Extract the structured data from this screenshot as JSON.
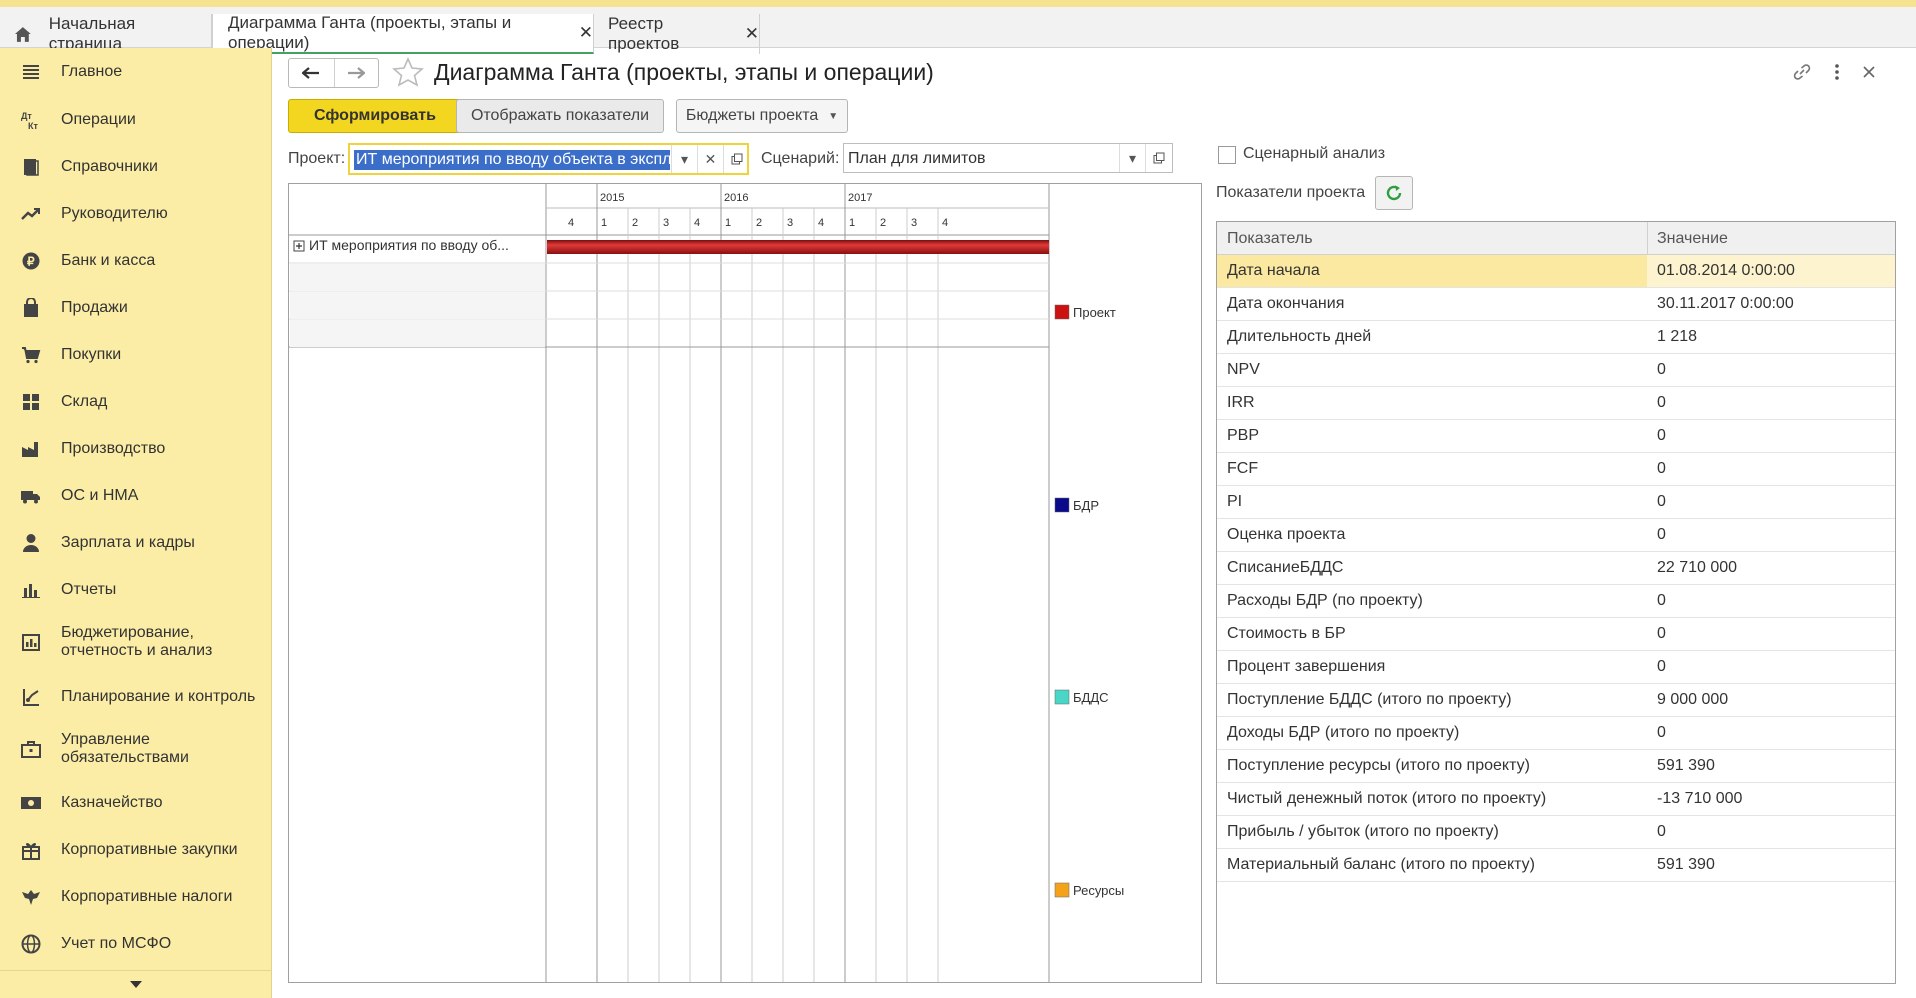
{
  "tabs": {
    "home": "Начальная страница",
    "gantt": "Диаграмма Ганта (проекты, этапы и операции)",
    "registry": "Реестр проектов"
  },
  "sidebar": {
    "items": [
      {
        "label": "Главное",
        "icon": "menu-icon"
      },
      {
        "label": "Операции",
        "icon": "dt-kt-icon"
      },
      {
        "label": "Справочники",
        "icon": "book-icon"
      },
      {
        "label": "Руководителю",
        "icon": "trend-icon"
      },
      {
        "label": "Банк и касса",
        "icon": "coin-icon"
      },
      {
        "label": "Продажи",
        "icon": "bag-icon"
      },
      {
        "label": "Покупки",
        "icon": "cart-icon"
      },
      {
        "label": "Склад",
        "icon": "grid-icon"
      },
      {
        "label": "Производство",
        "icon": "factory-icon"
      },
      {
        "label": "ОС и НМА",
        "icon": "truck-icon"
      },
      {
        "label": "Зарплата и кадры",
        "icon": "person-icon"
      },
      {
        "label": "Отчеты",
        "icon": "bar-chart-icon"
      },
      {
        "label": "Бюджетирование,\nотчетность и анализ",
        "icon": "budget-icon"
      },
      {
        "label": "Планирование и контроль",
        "icon": "planning-icon"
      },
      {
        "label": "Управление\nобязательствами",
        "icon": "briefcase-icon"
      },
      {
        "label": "Казначейство",
        "icon": "money-icon"
      },
      {
        "label": "Корпоративные закупки",
        "icon": "gift-icon"
      },
      {
        "label": "Корпоративные налоги",
        "icon": "eagle-icon"
      },
      {
        "label": "Учет по МСФО",
        "icon": "globe-icon"
      }
    ]
  },
  "form": {
    "title": "Диаграмма Ганта (проекты, этапы и операции)",
    "btn_form": "Сформировать",
    "btn_show": "Отображать показатели",
    "btn_budget": "Бюджеты проекта",
    "project_label": "Проект:",
    "project_value": "ИТ мероприятия по вводу объекта в эксплуатацию",
    "scenario_label": "Сценарий:",
    "scenario_value": "План для лимитов",
    "scenario_analysis": "Сценарный анализ",
    "indicators_label": "Показатели проекта"
  },
  "gantt": {
    "years": [
      "2015",
      "2016",
      "2017"
    ],
    "quarters": [
      "4",
      "1",
      "2",
      "3",
      "4",
      "1",
      "2",
      "3",
      "4",
      "1",
      "2",
      "3",
      "4"
    ],
    "row_label": "ИТ мероприятия по вводу об...",
    "bar_color": "#cc1f1f",
    "legend": [
      {
        "label": "Проект",
        "color": "#cc1111"
      },
      {
        "label": "БДР",
        "color": "#0a0a8a"
      },
      {
        "label": "БДДС",
        "color": "#4ad6c6"
      },
      {
        "label": "Ресурсы",
        "color": "#f5a21b"
      }
    ]
  },
  "indicators": {
    "head_name": "Показатель",
    "head_value": "Значение",
    "rows": [
      {
        "name": "Дата начала",
        "value": "01.08.2014 0:00:00"
      },
      {
        "name": "Дата окончания",
        "value": "30.11.2017 0:00:00"
      },
      {
        "name": "Длительность дней",
        "value": "1 218"
      },
      {
        "name": "NPV",
        "value": "0"
      },
      {
        "name": "IRR",
        "value": "0"
      },
      {
        "name": "PBP",
        "value": "0"
      },
      {
        "name": "FCF",
        "value": "0"
      },
      {
        "name": "PI",
        "value": "0"
      },
      {
        "name": "Оценка проекта",
        "value": "0"
      },
      {
        "name": "СписаниеБДДС",
        "value": "22 710 000"
      },
      {
        "name": "Расходы БДР (по проекту)",
        "value": "0"
      },
      {
        "name": "Стоимость в БР",
        "value": "0"
      },
      {
        "name": "Процент завершения",
        "value": "0"
      },
      {
        "name": "Поступление БДДС (итого по проекту)",
        "value": "9 000 000"
      },
      {
        "name": "Доходы БДР (итого по проекту)",
        "value": "0"
      },
      {
        "name": "Поступление ресурсы (итого по проекту)",
        "value": "591 390"
      },
      {
        "name": "Чистый денежный поток (итого по проекту)",
        "value": "-13 710 000"
      },
      {
        "name": "Прибыль / убыток (итого по проекту)",
        "value": "0"
      },
      {
        "name": "Материальный баланс (итого по проекту)",
        "value": "591 390"
      }
    ]
  }
}
